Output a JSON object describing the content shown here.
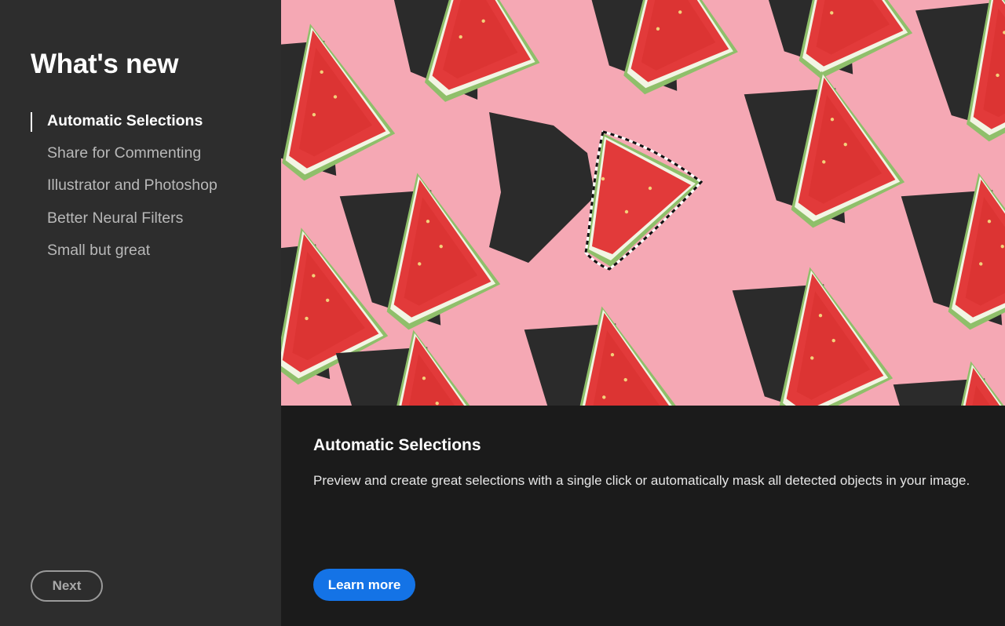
{
  "sidebar": {
    "title": "What's new",
    "items": [
      {
        "label": "Automatic Selections",
        "active": true
      },
      {
        "label": "Share for Commenting",
        "active": false
      },
      {
        "label": "Illustrator and Photoshop",
        "active": false
      },
      {
        "label": "Better Neural Filters",
        "active": false
      },
      {
        "label": "Small but great",
        "active": false
      }
    ],
    "next_label": "Next"
  },
  "main": {
    "title": "Automatic Selections",
    "description": "Preview and create great selections with a single click or automatically mask all detected objects in your image.",
    "learn_more_label": "Learn more"
  },
  "colors": {
    "sidebar_bg": "#2d2d2d",
    "main_bg": "#1b1b1b",
    "accent": "#1473e6",
    "hero_bg": "#f5a8b4"
  }
}
